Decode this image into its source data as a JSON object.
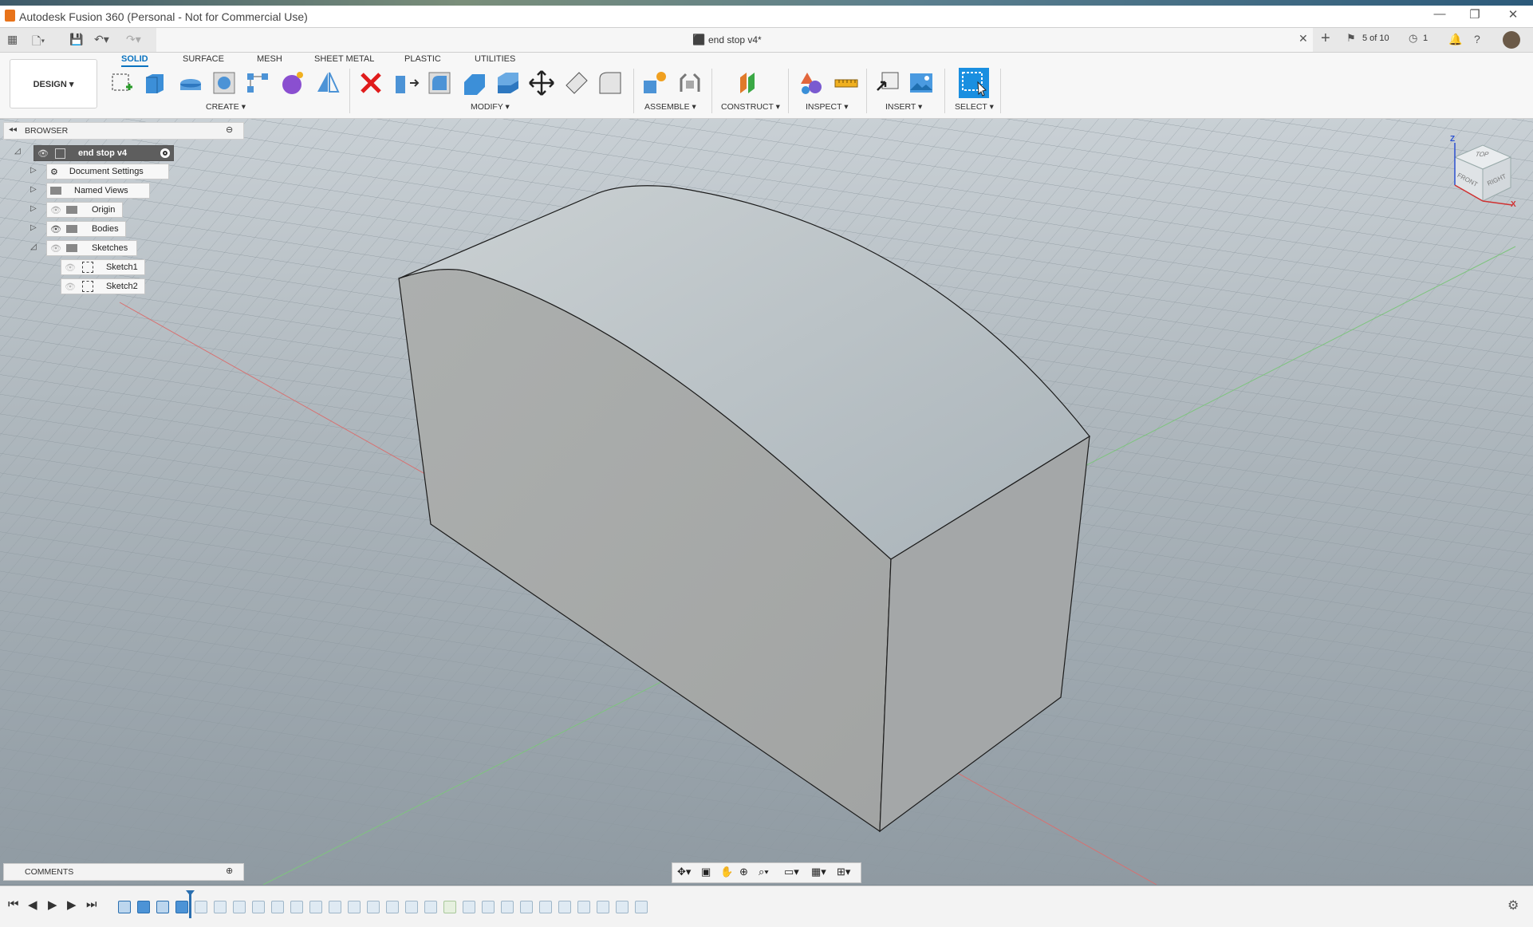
{
  "window": {
    "title": "Autodesk Fusion 360 (Personal - Not for Commercial Use)",
    "minimize": "—",
    "maximize": "❐",
    "close": "✕"
  },
  "doc_tab": {
    "title": "end stop v4*",
    "close": "✕",
    "new_tab": "+",
    "versions": "5 of 10",
    "jobs": "1"
  },
  "workspace": {
    "label": "DESIGN ▾"
  },
  "tabs": [
    "SOLID",
    "SURFACE",
    "MESH",
    "SHEET METAL",
    "PLASTIC",
    "UTILITIES"
  ],
  "groups": {
    "create": "CREATE ▾",
    "modify": "MODIFY ▾",
    "assemble": "ASSEMBLE ▾",
    "construct": "CONSTRUCT ▾",
    "inspect": "INSPECT ▾",
    "insert": "INSERT ▾",
    "select": "SELECT ▾"
  },
  "browser": {
    "title": "BROWSER",
    "root": "end stop v4",
    "items": [
      "Document Settings",
      "Named Views",
      "Origin",
      "Bodies",
      "Sketches"
    ],
    "sketches": [
      "Sketch1",
      "Sketch2"
    ]
  },
  "comments": {
    "title": "COMMENTS"
  },
  "viewcube": {
    "top": "TOP",
    "front": "FRONT",
    "right": "RIGHT",
    "z": "Z",
    "x": "X"
  },
  "colors": {
    "accent": "#0a73c0",
    "body_front": "#a7a9a8",
    "body_top": "#b6bec3",
    "body_side": "#a3a6a7"
  }
}
